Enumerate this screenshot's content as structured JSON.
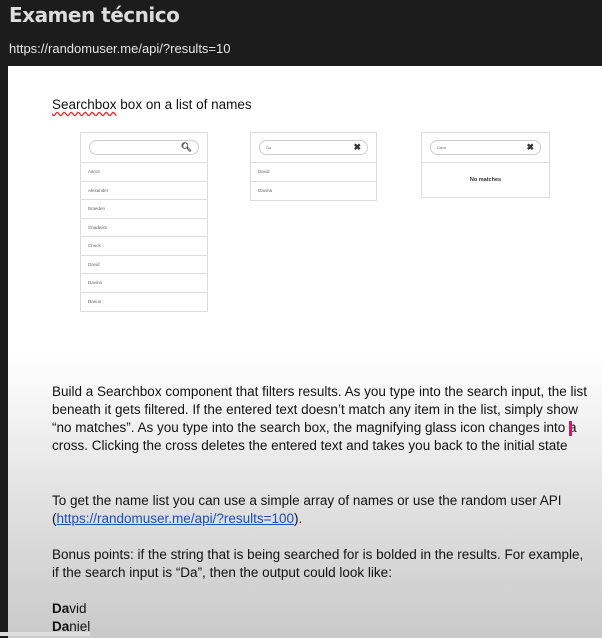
{
  "header": {
    "title": "Examen técnico",
    "url": "https://randomuser.me/api/?results=10"
  },
  "doc": {
    "heading_word": "Searchbox",
    "heading_rest": " box on a list of names",
    "mockups": [
      {
        "query": "",
        "icon": "search-icon",
        "items": [
          "Aaron",
          "Alexander",
          "Braeden",
          "Chadwick",
          "Chuck",
          "David",
          "Davina",
          "Darius"
        ]
      },
      {
        "query": "Da",
        "icon": "close-icon",
        "items": [
          "David",
          "Davina"
        ]
      },
      {
        "query": "Dave",
        "icon": "close-icon",
        "items": [],
        "empty_text": "No matches"
      }
    ],
    "para1": "Build a Searchbox component that filters results. As you type into the search input, the list beneath it gets filtered. If the entered text doesn’t match any item in the list, simply show “no matches”. As you type into the search box, the magnifying glass icon changes into a cross. Clicking the cross deletes the entered text and takes you back to the initial state",
    "para2_text": "To get the name list you can use a simple array of names or use the random user API (",
    "para2_link": "https://randomuser.me/api/?results=100",
    "para2_end": ").",
    "para3": "Bonus points: if the string that is being searched for is bolded in the results. For example, if the search input is “Da”, then the output could look like:",
    "examples": [
      {
        "bold": "Da",
        "rest": "vid"
      },
      {
        "bold": "Da",
        "rest": "niel"
      }
    ]
  },
  "video": {
    "progress": 0.15
  }
}
